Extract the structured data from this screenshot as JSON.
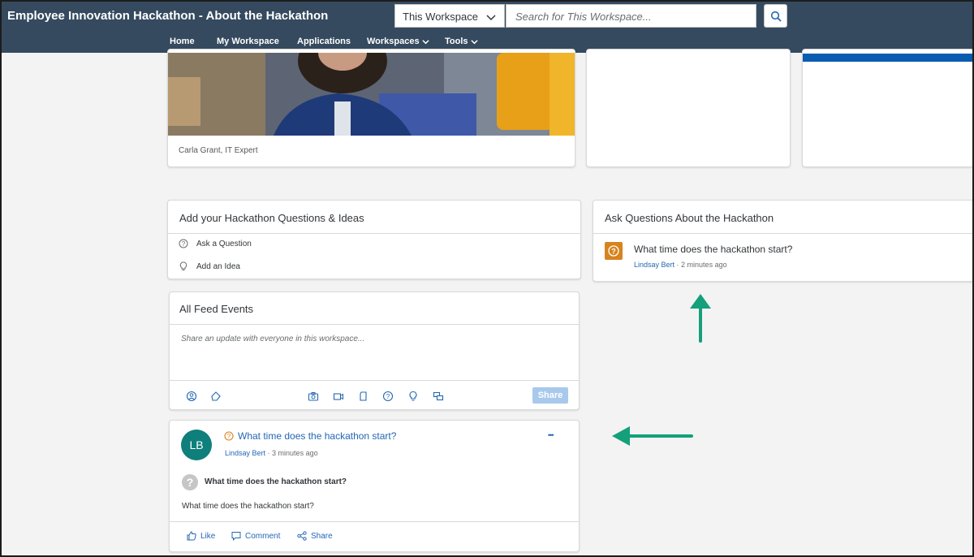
{
  "header": {
    "title": "Employee Innovation Hackathon - About the Hackathon",
    "scope": "This Workspace",
    "search_placeholder": "Search for This Workspace...",
    "nav": [
      "Home",
      "My Workspace",
      "Applications",
      "Workspaces",
      "Tools"
    ]
  },
  "hero": {
    "caption": "Carla Grant, IT Expert"
  },
  "ideas": {
    "title": "Add your Hackathon Questions & Ideas",
    "ask_question": "Ask a Question",
    "add_idea": "Add an Idea"
  },
  "questions": {
    "title": "Ask Questions About the Hackathon",
    "item_text": "What time does the hackathon start?",
    "author": "Lindsay Bert",
    "time": "2 minutes ago"
  },
  "feed": {
    "title": "All Feed Events",
    "placeholder": "Share an update with everyone in this workspace...",
    "share": "Share"
  },
  "post": {
    "avatar": "LB",
    "title": "What time does the hackathon start?",
    "author": "Lindsay Bert",
    "time": "3 minutes ago",
    "more": "•••",
    "question_bold": "What time does the hackathon start?",
    "question_text": "What time does the hackathon start?",
    "like": "Like",
    "comment": "Comment",
    "share": "Share"
  },
  "icons": {
    "search": "search-icon",
    "question": "question-icon",
    "idea": "lightbulb-icon",
    "camera": "camera-icon",
    "video": "video-icon",
    "document": "document-icon",
    "like": "thumbs-up-icon",
    "comment": "comment-icon",
    "share": "share-icon"
  },
  "colors": {
    "header": "#354a5f",
    "link": "#2467b4",
    "accent_orange": "#d6841f",
    "avatar": "#0e7f7a",
    "annotation_arrow": "#14a07a"
  }
}
